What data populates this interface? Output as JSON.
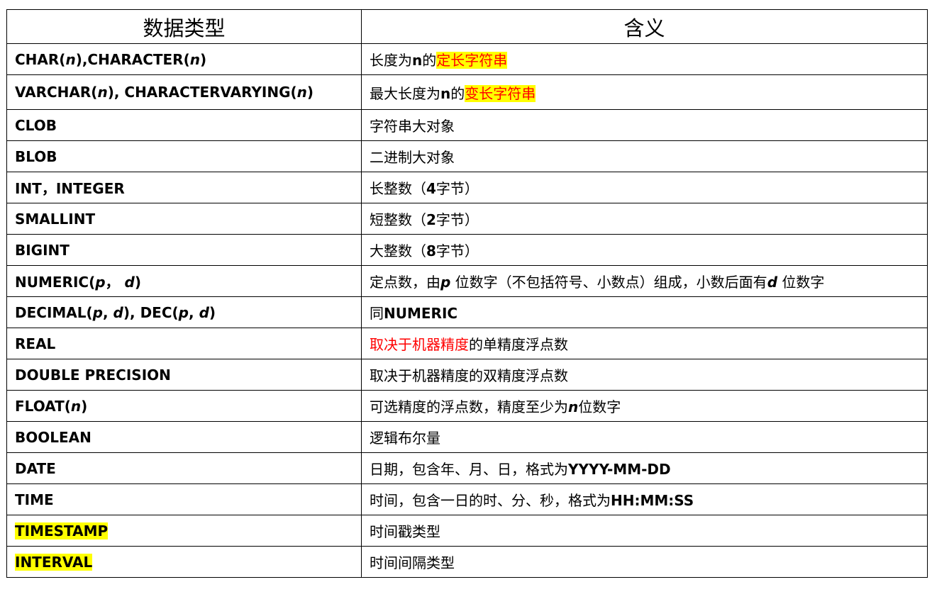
{
  "header": {
    "type_col": "数据类型",
    "meaning_col": "含义"
  },
  "colors": {
    "highlight": "#ffff00",
    "emphasis_red": "#ff0000",
    "border": "#000000"
  },
  "rows": [
    {
      "type": [
        {
          "t": "CHAR("
        },
        {
          "t": "n",
          "s": "i"
        },
        {
          "t": "),CHARACTER("
        },
        {
          "t": "n",
          "s": "i"
        },
        {
          "t": ")"
        }
      ],
      "meaning": [
        {
          "t": "长度为"
        },
        {
          "t": "n",
          "s": "b"
        },
        {
          "t": "的"
        },
        {
          "t": "定长字符串",
          "s": "red hl"
        }
      ]
    },
    {
      "tall": true,
      "type": [
        {
          "t": "VARCHAR("
        },
        {
          "t": "n",
          "s": "i"
        },
        {
          "t": "), CHARACTERVARYING("
        },
        {
          "t": "n",
          "s": "i"
        },
        {
          "t": ")"
        }
      ],
      "meaning": [
        {
          "t": "最大长度为"
        },
        {
          "t": "n",
          "s": "b"
        },
        {
          "t": "的"
        },
        {
          "t": "变长字符串",
          "s": "red hl"
        }
      ]
    },
    {
      "type": [
        {
          "t": "CLOB"
        }
      ],
      "meaning": [
        {
          "t": "字符串大对象"
        }
      ]
    },
    {
      "type": [
        {
          "t": "BLOB"
        }
      ],
      "meaning": [
        {
          "t": "二进制大对象"
        }
      ]
    },
    {
      "type": [
        {
          "t": "INT，INTEGER"
        }
      ],
      "meaning": [
        {
          "t": "长整数（"
        },
        {
          "t": "4",
          "s": "b"
        },
        {
          "t": "字节）"
        }
      ]
    },
    {
      "type": [
        {
          "t": "SMALLINT"
        }
      ],
      "meaning": [
        {
          "t": "短整数（"
        },
        {
          "t": "2",
          "s": "b"
        },
        {
          "t": "字节）"
        }
      ]
    },
    {
      "type": [
        {
          "t": "BIGINT"
        }
      ],
      "meaning": [
        {
          "t": "大整数（"
        },
        {
          "t": "8",
          "s": "b"
        },
        {
          "t": "字节）"
        }
      ]
    },
    {
      "type": [
        {
          "t": "NUMERIC("
        },
        {
          "t": "p",
          "s": "i"
        },
        {
          "t": "， "
        },
        {
          "t": "d",
          "s": "i"
        },
        {
          "t": ")"
        }
      ],
      "meaning": [
        {
          "t": "定点数，由"
        },
        {
          "t": "p",
          "s": "i"
        },
        {
          "t": " 位数字（不包括符号、小数点）组成，小数后面有"
        },
        {
          "t": "d",
          "s": "i"
        },
        {
          "t": " 位数字"
        }
      ]
    },
    {
      "type": [
        {
          "t": "DECIMAL("
        },
        {
          "t": "p",
          "s": "i"
        },
        {
          "t": ", "
        },
        {
          "t": "d",
          "s": "i"
        },
        {
          "t": "), DEC("
        },
        {
          "t": "p",
          "s": "i"
        },
        {
          "t": ", "
        },
        {
          "t": "d",
          "s": "i"
        },
        {
          "t": ")"
        }
      ],
      "meaning": [
        {
          "t": "同"
        },
        {
          "t": "NUMERIC",
          "s": "b"
        }
      ]
    },
    {
      "type": [
        {
          "t": "REAL"
        }
      ],
      "meaning": [
        {
          "t": "取决于机器精度",
          "s": "red"
        },
        {
          "t": "的单精度浮点数"
        }
      ]
    },
    {
      "type": [
        {
          "t": "DOUBLE PRECISION"
        }
      ],
      "meaning": [
        {
          "t": "取决于机器精度的双精度浮点数"
        }
      ]
    },
    {
      "type": [
        {
          "t": "FLOAT("
        },
        {
          "t": "n",
          "s": "i"
        },
        {
          "t": ")"
        }
      ],
      "meaning": [
        {
          "t": "可选精度的浮点数，精度至少为"
        },
        {
          "t": "n",
          "s": "i"
        },
        {
          "t": "位数字"
        }
      ]
    },
    {
      "type": [
        {
          "t": "BOOLEAN"
        }
      ],
      "meaning": [
        {
          "t": "逻辑布尔量"
        }
      ]
    },
    {
      "type": [
        {
          "t": "DATE"
        }
      ],
      "meaning": [
        {
          "t": "日期，包含年、月、日，格式为"
        },
        {
          "t": "YYYY-MM-DD",
          "s": "b"
        }
      ]
    },
    {
      "type": [
        {
          "t": "TIME"
        }
      ],
      "meaning": [
        {
          "t": "时间，包含一日的时、分、秒，格式为"
        },
        {
          "t": "HH:MM:SS",
          "s": "b"
        }
      ]
    },
    {
      "type": [
        {
          "t": "TIMESTAMP",
          "s": "hl"
        }
      ],
      "meaning": [
        {
          "t": "时间戳类型"
        }
      ]
    },
    {
      "type": [
        {
          "t": "INTERVAL",
          "s": "hl"
        }
      ],
      "meaning": [
        {
          "t": "时间间隔类型"
        }
      ]
    }
  ]
}
